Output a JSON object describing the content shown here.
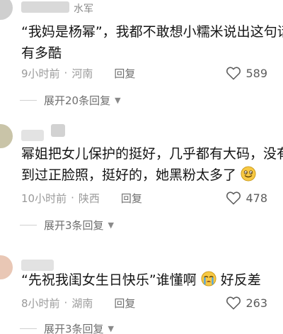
{
  "comments": [
    {
      "username": "水军",
      "body_lines": [
        "“我妈是杨幂”，我都不敢想小糯米说出这句话",
        "有多酷"
      ],
      "time": "9小时前",
      "location": "河南",
      "reply_label": "回复",
      "likes": "589",
      "expand_label": "展开20条回复"
    },
    {
      "username": "",
      "body_lines": [
        "幂姐把女儿保护的挺好，几乎都有大码，没有",
        "到过正脸照，挺好的，她黑粉太多了"
      ],
      "time": "10小时前",
      "location": "陕西",
      "reply_label": "回复",
      "likes": "478",
      "expand_label": "展开3条回复",
      "emoji": "smiling-face-icon"
    },
    {
      "username": "",
      "body_lines": [
        "“先祝我闺女生日快乐”谁懂啊",
        "好反差"
      ],
      "time": "8小时前",
      "location": "湖南",
      "reply_label": "回复",
      "likes": "263",
      "expand_label": "展开3条回复",
      "emoji": "crying-face-icon"
    }
  ],
  "separator": "·",
  "colors": {
    "text": "#141414",
    "meta": "#9a9a9a",
    "link": "#6f6f6f",
    "emoji_yellow": "#f7c843"
  }
}
